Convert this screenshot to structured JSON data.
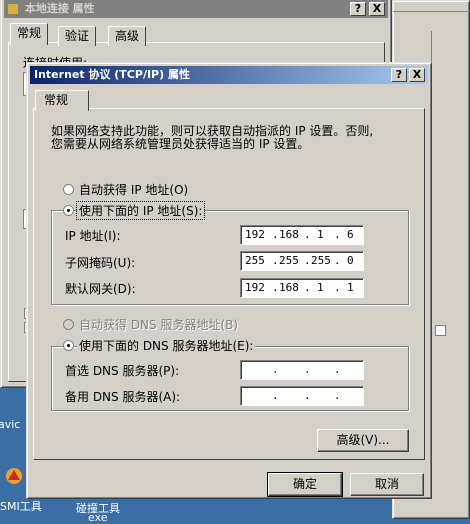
{
  "desktop": {
    "labels": [
      "avic",
      "SMI工具",
      "碰撞工具",
      "exe"
    ]
  },
  "bg_window": {
    "title": "本地连接 属性",
    "tabs": [
      "常规",
      "验证",
      "高级"
    ],
    "connect_using_label": "连接时使用:",
    "help_btn": "?",
    "close_btn": "X"
  },
  "dialog": {
    "title": "Internet 协议 (TCP/IP) 属性",
    "help_btn": "?",
    "close_btn": "X",
    "tab": "常规",
    "description_line1": "如果网络支持此功能，则可以获取自动指派的 IP 设置。否则,",
    "description_line2": "您需要从网络系统管理员处获得适当的 IP 设置。",
    "auto_ip_label": "自动获得 IP 地址(O)",
    "manual_ip_label": "使用下面的 IP 地址(S):",
    "ip_label": "IP 地址(I):",
    "ip_value": [
      "192",
      "168",
      "1",
      "6"
    ],
    "mask_label": "子网掩码(U):",
    "mask_value": [
      "255",
      "255",
      "255",
      "0"
    ],
    "gateway_label": "默认网关(D):",
    "gateway_value": [
      "192",
      "168",
      "1",
      "1"
    ],
    "auto_dns_label": "自动获得 DNS 服务器地址(B)",
    "manual_dns_label": "使用下面的 DNS 服务器地址(E):",
    "preferred_dns_label": "首选 DNS 服务器(P):",
    "alternate_dns_label": "备用 DNS 服务器(A):",
    "advanced_btn": "高级(V)...",
    "ok_btn": "确定",
    "cancel_btn": "取消"
  }
}
